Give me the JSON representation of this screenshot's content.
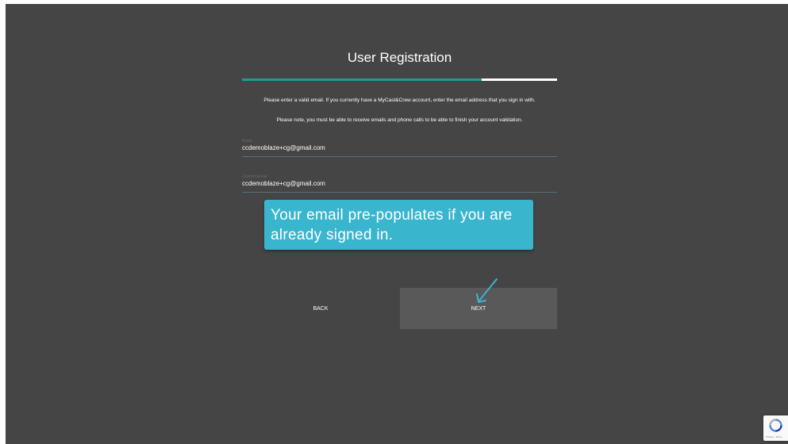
{
  "page": {
    "title": "User Registration",
    "progress_fraction": 0.76
  },
  "instructions": {
    "line1": "Please enter a valid email. If you currently have a MyCast&Crew account, enter the email address that you sign in with.",
    "line2": "Please note, you must be able to receive emails and phone calls to be able to finish your account validation."
  },
  "form": {
    "email_label": "Email",
    "email_value": "ccdemoblaze+cg@gmail.com",
    "confirm_label": "Confirm Email",
    "confirm_value": "ccdemoblaze+cg@gmail.com"
  },
  "tooltip": {
    "text": "Your email pre-populates if you are already signed in."
  },
  "buttons": {
    "back_label": "BACK",
    "next_label": "NEXT"
  },
  "recaptcha": {
    "text": "Privacy - Terms",
    "icon": "recaptcha-icon"
  },
  "colors": {
    "background": "#454545",
    "accent": "#1e9a93",
    "tooltip": "#3ab5ce",
    "next_button": "#595959"
  }
}
